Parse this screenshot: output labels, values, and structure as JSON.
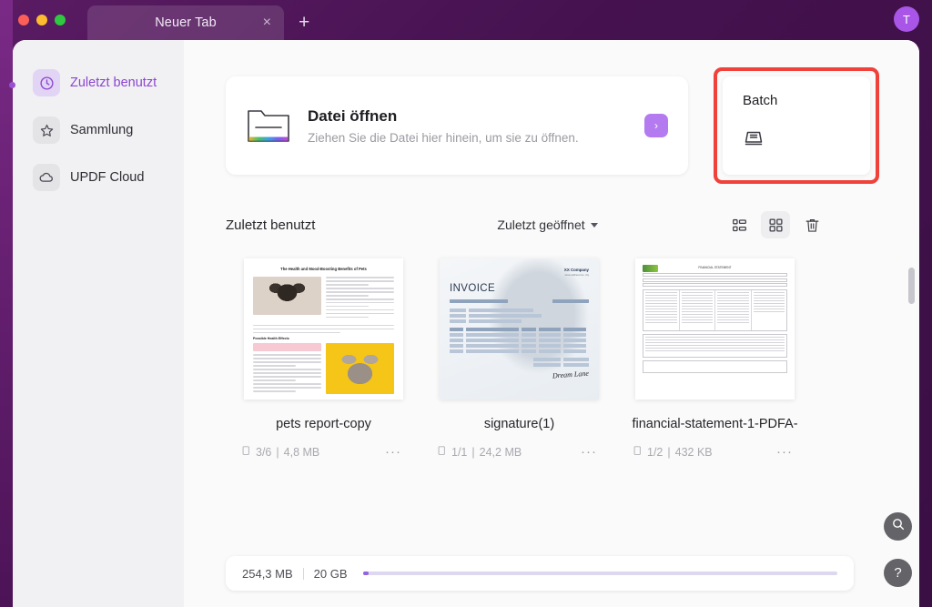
{
  "window": {
    "traffic_lights": [
      "close",
      "minimize",
      "maximize"
    ],
    "tab_title": "Neuer Tab",
    "tab_close_glyph": "×",
    "new_tab_glyph": "+",
    "avatar_initial": "T",
    "accent_color": "#9264e0",
    "frame_color": "#4c1356",
    "highlight_color": "#f0413a"
  },
  "sidebar": {
    "items": [
      {
        "label": "Zuletzt benutzt",
        "icon": "clock-icon",
        "active": true
      },
      {
        "label": "Sammlung",
        "icon": "star-icon",
        "active": false
      },
      {
        "label": "UPDF Cloud",
        "icon": "cloud-icon",
        "active": false
      }
    ]
  },
  "open_card": {
    "title": "Datei öffnen",
    "subtitle": "Ziehen Sie die Datei hier hinein, um sie zu öffnen.",
    "icon": "folder-icon",
    "arrow_glyph": "›"
  },
  "batch_card": {
    "title": "Batch",
    "icon": "batch-stack-icon",
    "highlighted": true
  },
  "toolbar": {
    "section_title": "Zuletzt benutzt",
    "sort_label": "Zuletzt geöffnet",
    "views": [
      {
        "name": "list-view",
        "active": false
      },
      {
        "name": "grid-view",
        "active": true
      }
    ],
    "delete_label": "trash-icon"
  },
  "files": [
    {
      "name": "pets report-copy",
      "pages": "3/6",
      "size": "4,8 MB",
      "cloud": false,
      "more_glyph": "···",
      "thumb": {
        "kind": "pets-report",
        "heading": "The Health and Mood-Boosting Benefits of Pets",
        "subheading": "Possible Health Effects"
      }
    },
    {
      "name": "signature(1)",
      "pages": "1/1",
      "size": "24,2 MB",
      "cloud": true,
      "more_glyph": "···",
      "thumb": {
        "kind": "invoice",
        "company": "XX Company",
        "company_sub": "street address line, city",
        "title": "INVOICE",
        "signature": "Dream Lane"
      }
    },
    {
      "name": "financial-statement-1-PDFA-",
      "pages": "1/2",
      "size": "432 KB",
      "cloud": false,
      "more_glyph": "···",
      "thumb": {
        "kind": "form",
        "logo": "UPDF",
        "title": "FINANCIAL STATEMENT"
      }
    }
  ],
  "storage": {
    "used": "254,3 MB",
    "total": "20 GB",
    "percent": 1.2
  },
  "fabs": [
    {
      "name": "search-fab",
      "glyph": "search-icon"
    },
    {
      "name": "help-fab",
      "glyph": "?"
    }
  ]
}
